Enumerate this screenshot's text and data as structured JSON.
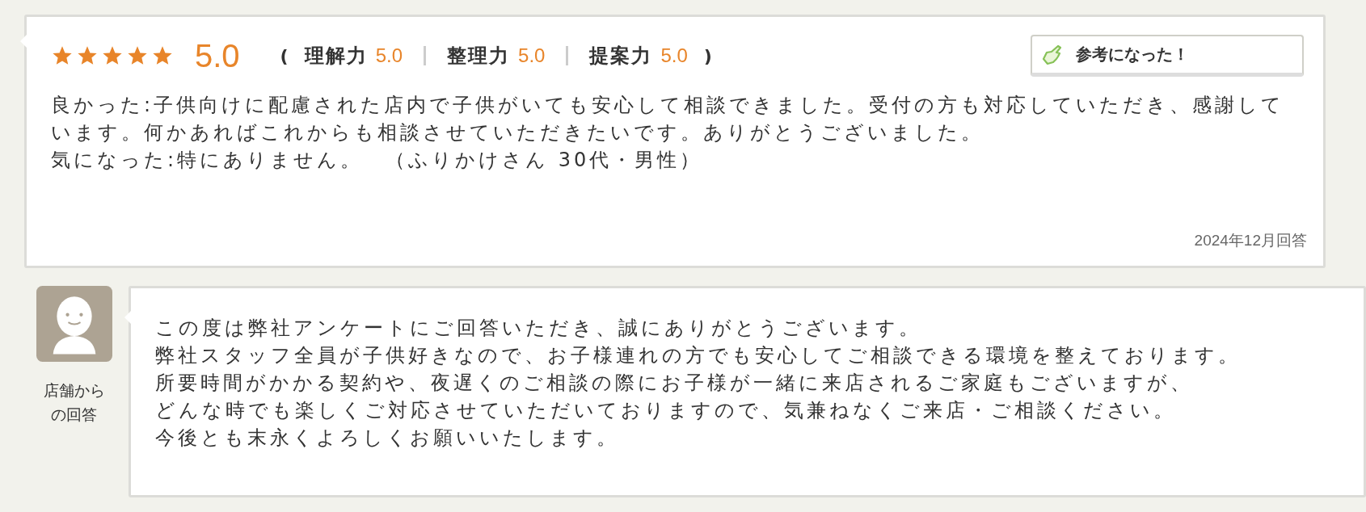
{
  "review": {
    "stars": 5,
    "score": "5.0",
    "open_paren": "(",
    "close_paren": ")",
    "sub_ratings": [
      {
        "label": "理解力",
        "value": "5.0"
      },
      {
        "label": "整理力",
        "value": "5.0"
      },
      {
        "label": "提案力",
        "value": "5.0"
      }
    ],
    "helpful_button": "参考になった！",
    "comment": [
      "良かった:子供向けに配慮された店内で子供がいても安心して相談できました。受付の方も対応していただき、感謝しています。何かあればこれからも相談させていただきたいです。ありがとうございました。",
      "気になった:特にありません。　（ふりかけさん 30代・男性）"
    ],
    "date": "2024年12月回答"
  },
  "reply": {
    "label": "店舗からの回答",
    "lines": [
      "この度は弊社アンケートにご回答いただき、誠にありがとうございます。",
      "弊社スタッフ全員が子供好きなので、お子様連れの方でも安心してご相談できる環境を整えております。",
      "所要時間がかかる契約や、夜遅くのご相談の際にお子様が一緒に来店されるご家庭もございますが、",
      "どんな時でも楽しくご対応させていただいておりますので、気兼ねなくご来店・ご相談ください。",
      "今後とも末永くよろしくお願いいたします。"
    ]
  }
}
